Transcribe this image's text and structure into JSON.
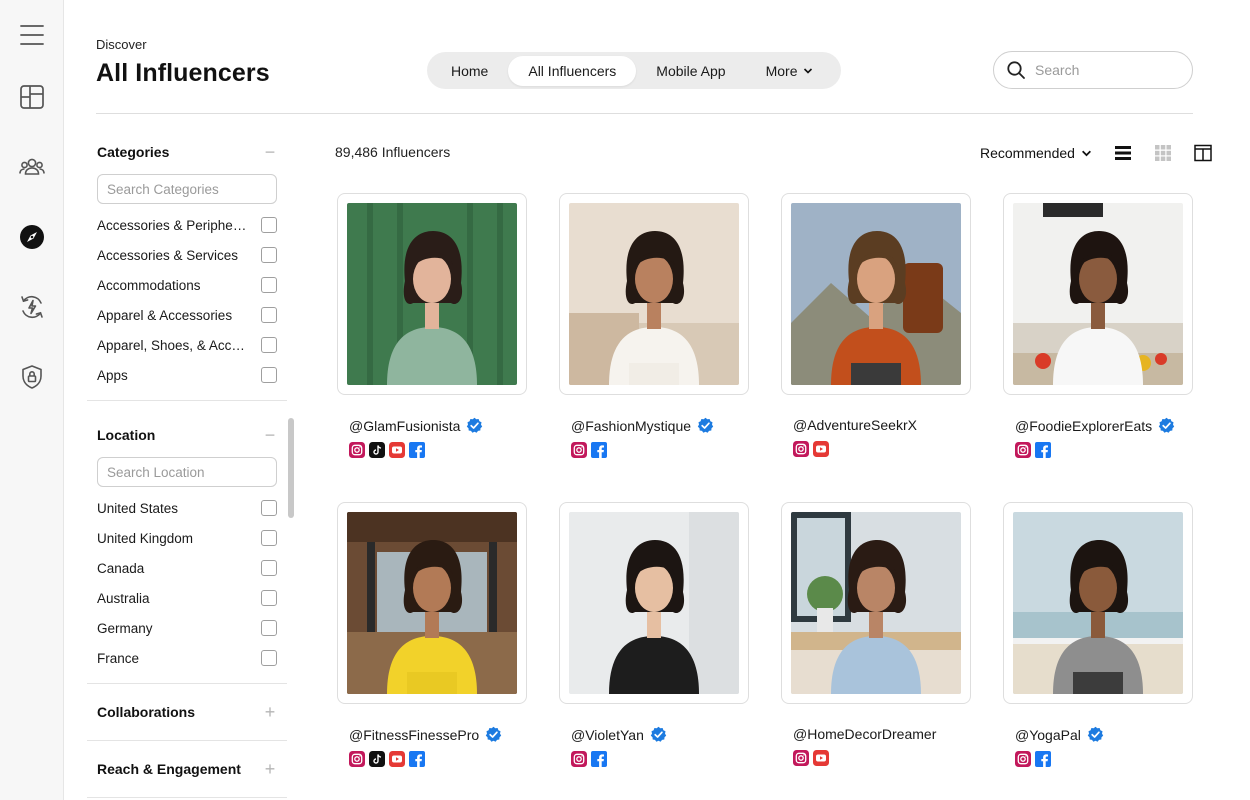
{
  "header": {
    "breadcrumb": "Discover",
    "title": "All Influencers",
    "tabs": [
      {
        "label": "Home"
      },
      {
        "label": "All Influencers"
      },
      {
        "label": "Mobile App"
      },
      {
        "label": "More"
      }
    ],
    "active_tab": "All Influencers",
    "search_placeholder": "Search"
  },
  "rail": {
    "items": [
      {
        "icon": "menu-icon"
      },
      {
        "icon": "dashboard-icon"
      },
      {
        "icon": "users-icon"
      },
      {
        "icon": "compass-icon",
        "active": true
      },
      {
        "icon": "refresh-bolt-icon"
      },
      {
        "icon": "shield-lock-icon"
      }
    ]
  },
  "filters": {
    "categories": {
      "title": "Categories",
      "toggle": "−",
      "search_placeholder": "Search Categories",
      "items": [
        {
          "label": "Accessories & Peripher..."
        },
        {
          "label": "Accessories & Services"
        },
        {
          "label": "Accommodations"
        },
        {
          "label": "Apparel & Accessories"
        },
        {
          "label": "Apparel, Shoes, & Acce..."
        },
        {
          "label": "Apps"
        }
      ]
    },
    "location": {
      "title": "Location",
      "toggle": "−",
      "search_placeholder": "Search Location",
      "items": [
        {
          "label": "United States"
        },
        {
          "label": "United Kingdom"
        },
        {
          "label": "Canada"
        },
        {
          "label": "Australia"
        },
        {
          "label": "Germany"
        },
        {
          "label": "France"
        }
      ]
    },
    "collaborations": {
      "title": "Collaborations",
      "toggle": "+"
    },
    "reach": {
      "title": "Reach & Engagement",
      "toggle": "+"
    }
  },
  "results": {
    "count_label": "89,486 Influencers",
    "sort_label": "Recommended",
    "view_modes": [
      "list-view-icon",
      "grid-view-icon",
      "split-view-icon"
    ]
  },
  "influencers": [
    {
      "handle": "@GlamFusionista",
      "verified": true,
      "socials": [
        "instagram",
        "tiktok",
        "youtube",
        "facebook"
      ]
    },
    {
      "handle": "@FashionMystique",
      "verified": true,
      "socials": [
        "instagram",
        "facebook"
      ]
    },
    {
      "handle": "@AdventureSeekrX",
      "verified": false,
      "socials": [
        "instagram",
        "youtube"
      ]
    },
    {
      "handle": "@FoodieExplorerEats",
      "verified": true,
      "socials": [
        "instagram",
        "facebook"
      ]
    },
    {
      "handle": "@FitnessFinessePro",
      "verified": true,
      "socials": [
        "instagram",
        "tiktok",
        "youtube",
        "facebook"
      ]
    },
    {
      "handle": "@VioletYan",
      "verified": true,
      "socials": [
        "instagram",
        "facebook"
      ]
    },
    {
      "handle": "@HomeDecorDreamer",
      "verified": false,
      "socials": [
        "instagram",
        "youtube"
      ]
    },
    {
      "handle": "@YogaPal",
      "verified": true,
      "socials": [
        "instagram",
        "facebook"
      ]
    }
  ],
  "colors": {
    "instagram": "#c2185b",
    "tiktok": "#111111",
    "youtube": "#e53935",
    "facebook": "#1877f2",
    "verified": "#1d7be0",
    "tab_track": "#ececec"
  }
}
